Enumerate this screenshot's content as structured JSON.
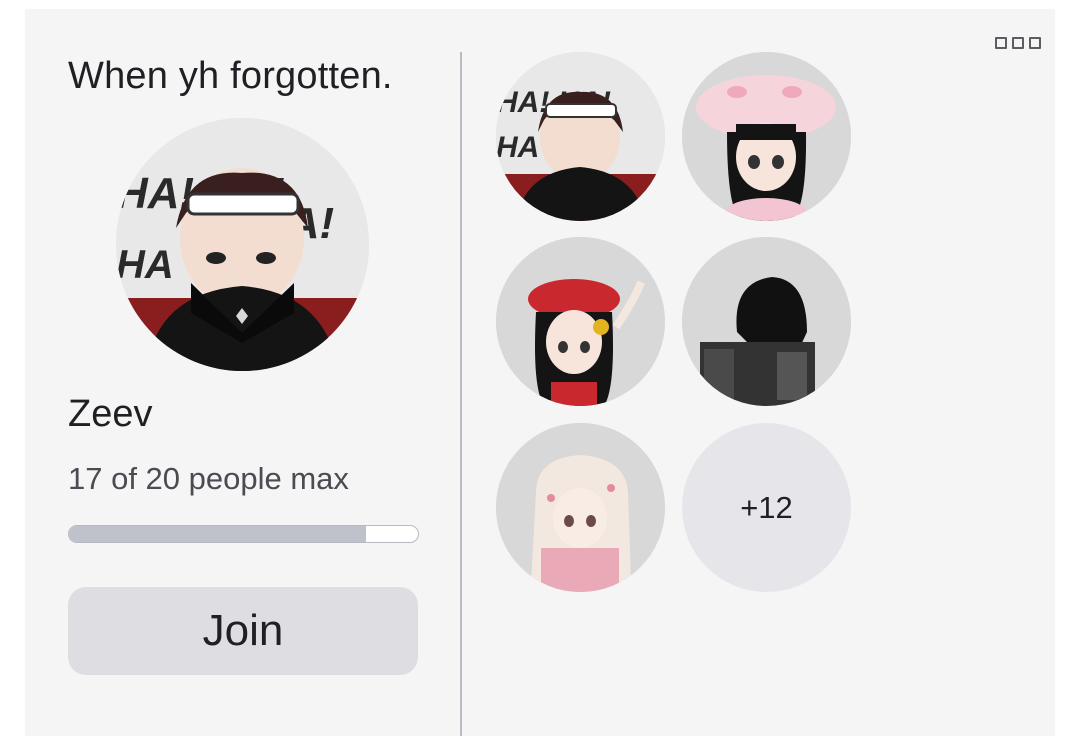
{
  "server": {
    "name": "When yh forgotten.",
    "host": "Zeev",
    "capacity_text": "17 of 20 people max",
    "players": 17,
    "max_players": 20,
    "join_label": "Join"
  },
  "players_panel": {
    "more_label": "+12"
  },
  "icons": {
    "menu": "more-options-icon"
  },
  "colors": {
    "card_bg": "#f5f5f6",
    "button_bg": "#dddde2",
    "progress_fill": "#bfc1cb"
  }
}
